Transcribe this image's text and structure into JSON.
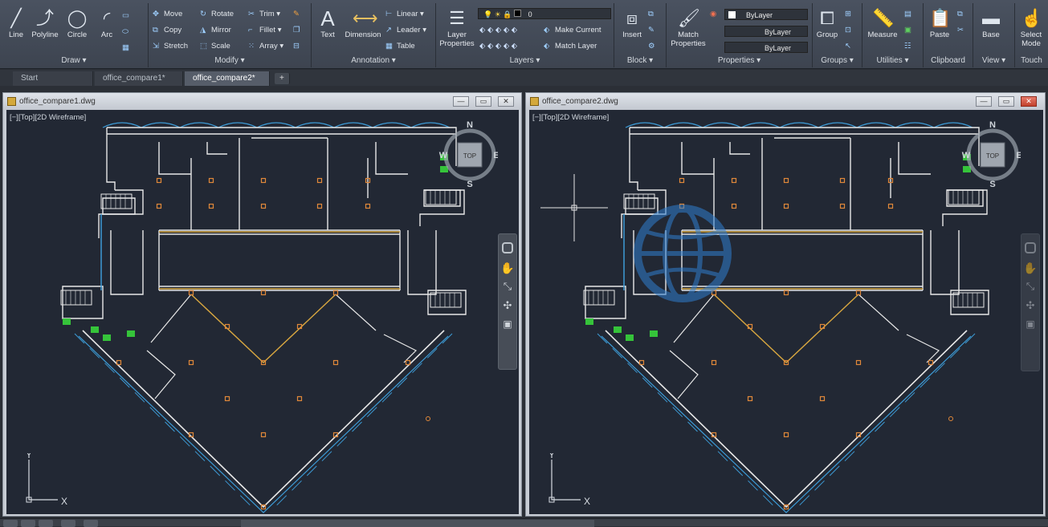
{
  "ribbon": {
    "draw": {
      "title": "Draw ▾",
      "line": "Line",
      "polyline": "Polyline",
      "circle": "Circle",
      "arc": "Arc"
    },
    "modify": {
      "title": "Modify ▾",
      "move": "Move",
      "rotate": "Rotate",
      "trim": "Trim ▾",
      "copy": "Copy",
      "mirror": "Mirror",
      "fillet": "Fillet ▾",
      "stretch": "Stretch",
      "scale": "Scale",
      "array": "Array ▾"
    },
    "annotation": {
      "title": "Annotation ▾",
      "text": "Text",
      "dimension": "Dimension",
      "linear": "Linear ▾",
      "leader": "Leader ▾",
      "table": "Table"
    },
    "layers": {
      "title": "Layers ▾",
      "layer_properties": "Layer Properties",
      "current_layer": "0",
      "make_current": "Make Current",
      "match_layer": "Match Layer"
    },
    "block": {
      "title": "Block ▾",
      "insert": "Insert"
    },
    "properties": {
      "title": "Properties ▾",
      "match_properties": "Match Properties",
      "color": "ByLayer",
      "linetype": "ByLayer",
      "lineweight": "ByLayer"
    },
    "groups": {
      "title": "Groups ▾",
      "group": "Group"
    },
    "utilities": {
      "title": "Utilities ▾",
      "measure": "Measure"
    },
    "clipboard": {
      "title": "Clipboard",
      "paste": "Paste"
    },
    "view": {
      "title": "View ▾",
      "base": "Base"
    },
    "touch": {
      "title": "Touch",
      "select_mode": "Select Mode"
    }
  },
  "tabs": {
    "start": "Start",
    "tab1": "office_compare1*",
    "tab2": "office_compare2*",
    "plus": "+"
  },
  "windows": {
    "left": {
      "title": "office_compare1.dwg",
      "viewport_label": "[−][Top][2D Wireframe]"
    },
    "right": {
      "title": "office_compare2.dwg",
      "viewport_label": "[−][Top][2D Wireframe]"
    }
  },
  "viewcube": {
    "n": "N",
    "e": "E",
    "s": "S",
    "w": "W",
    "top": "TOP"
  },
  "ucs": {
    "x": "X",
    "y": "Y"
  },
  "colors": {
    "background": "#222834",
    "wall": "#e8e8e8",
    "curtain": "#3d9bd6",
    "accent_orange": "#e0883a",
    "accent_green": "#35c43a"
  }
}
